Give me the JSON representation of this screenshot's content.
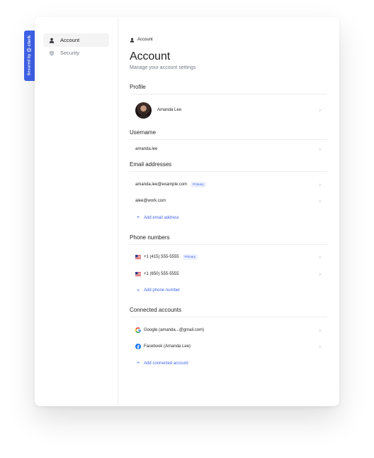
{
  "badge": {
    "text": "Secured by",
    "brand": "clerk",
    "color": "#3f63ec"
  },
  "sidebar": {
    "items": [
      {
        "label": "Account",
        "icon": "user-icon",
        "active": true
      },
      {
        "label": "Security",
        "icon": "shield-icon",
        "active": false
      }
    ]
  },
  "breadcrumb": {
    "label": "Account"
  },
  "page": {
    "title": "Account",
    "subtitle": "Manage your account settings"
  },
  "profile": {
    "title": "Profile",
    "name": "Amanda Lee"
  },
  "username": {
    "title": "Username",
    "value": "amanda.lee"
  },
  "emails": {
    "title": "Email addresses",
    "items": [
      {
        "value": "amanda.lee@example.com",
        "badge": "Primary"
      },
      {
        "value": "alee@work.com"
      }
    ],
    "add_label": "Add email address"
  },
  "phones": {
    "title": "Phone numbers",
    "items": [
      {
        "value": "+1 (415) 555-5555",
        "badge": "Primary",
        "flag": "us-flag-icon"
      },
      {
        "value": "+1 (650) 555-5555",
        "flag": "us-flag-icon"
      }
    ],
    "add_label": "Add phone number"
  },
  "connected": {
    "title": "Connected accounts",
    "items": [
      {
        "value": "Google (amanda...@gmail.com)",
        "icon": "google-icon"
      },
      {
        "value": "Facebook (Amanda Lee)",
        "icon": "facebook-icon"
      }
    ],
    "add_label": "Add connected account"
  },
  "colors": {
    "accent": "#3f63ec",
    "primary_badge_bg": "#eef1fd",
    "muted": "#747a86"
  }
}
